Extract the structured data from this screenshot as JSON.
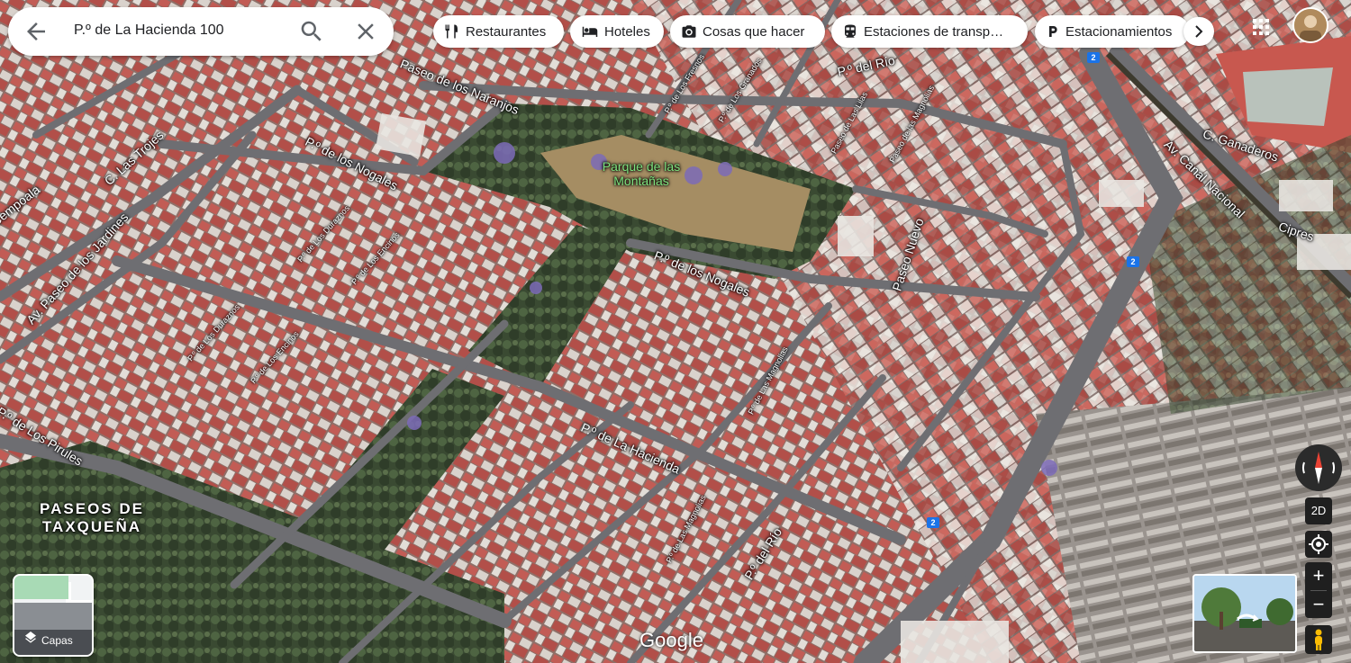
{
  "search": {
    "query": "P.º de La Hacienda 100"
  },
  "categories": [
    {
      "label": "Restaurantes",
      "icon": "fork-knife-icon"
    },
    {
      "label": "Hoteles",
      "icon": "bed-icon"
    },
    {
      "label": "Cosas que hacer",
      "icon": "camera-icon"
    },
    {
      "label": "Estaciones de transp…",
      "icon": "train-icon"
    },
    {
      "label": "Estacionamientos",
      "icon": "parking-icon"
    }
  ],
  "map_labels": {
    "paseo_naranjos": "Paseo de los Naranjos",
    "p_rio_top": "P.º del Río",
    "p_nogales_left": "P.º de los Nogales",
    "c_las_trojes": "C. Las Trojes",
    "empoala": "Cempoala",
    "parque": "Parque de las Montañas",
    "av_paseo_jardines": "Av. Paseo de los Jardines",
    "p_nogales_mid": "P.º de los Nogales",
    "paseo_nuevo": "Paseo Nuevo",
    "c_ganaderos": "C. Ganaderos",
    "av_canal_nacional": "Av. Canal Nacional",
    "cipres": "Cipres",
    "p_piru": "P.º de Los Pirules",
    "p_hacienda": "P.º de La Hacienda",
    "p_rio_bottom": "P.º del Río",
    "paseos_taxquena": "PASEOS DE TAXQUEÑA",
    "p_fresnos": "P.º de Los Fresnos",
    "p_granados": "P.º de Los Granados",
    "p_lavanda": "Paseo de Las Lilas",
    "paseo_magnolias": "Paseo de las Magnolias",
    "p_duraznos": "P.º de Los Duraznos",
    "p_encinos": "P.º de Los Encinos",
    "p_duraznos2": "P.º de Los Duraznos",
    "p_encinos2": "P.º de Los Encinos",
    "p_magnolias": "P.º de Las Magnolias",
    "p_magnolias2": "P.º de Las Magnolias",
    "route_2": "2"
  },
  "controls": {
    "layers_label": "Capas",
    "mode_2d": "2D",
    "zoom_in": "+",
    "zoom_out": "−"
  },
  "attribution": "Google",
  "colors": {
    "roof_red": "#b5564f",
    "road": "#6e6e72",
    "park_green": "#3f5a3a",
    "accent_blue": "#1a73e8"
  }
}
